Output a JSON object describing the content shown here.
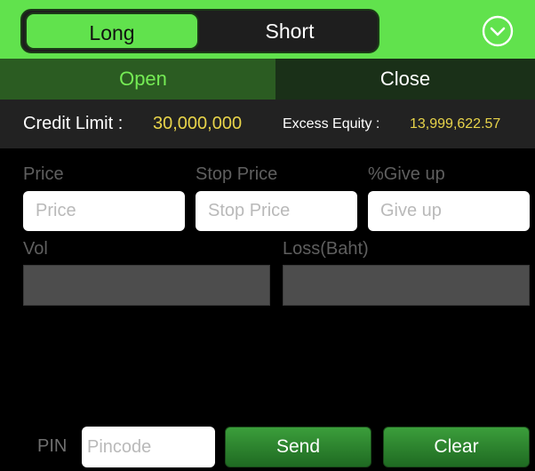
{
  "direction_toggle": {
    "long_label": "Long",
    "short_label": "Short",
    "selected": "Long"
  },
  "menu_icon": "chevron-down-circle-icon",
  "tabs": {
    "open_label": "Open",
    "close_label": "Close",
    "selected": "Open"
  },
  "credit": {
    "credit_limit_label": "Credit Limit :",
    "credit_limit_value": "30,000,000",
    "excess_equity_label": "Excess Equity :",
    "excess_equity_value": "13,999,622.57"
  },
  "form": {
    "price_label": "Price",
    "price_placeholder": "Price",
    "price_value": "",
    "stop_price_label": "Stop Price",
    "stop_price_placeholder": "Stop Price",
    "stop_price_value": "",
    "give_up_label": "%Give up",
    "give_up_placeholder": "Give up",
    "give_up_value": "",
    "vol_label": "Vol",
    "vol_value": "",
    "loss_label": "Loss(Baht)",
    "loss_value": ""
  },
  "footer": {
    "pin_label": "PIN",
    "pin_placeholder": "Pincode",
    "pin_value": "",
    "send_label": "Send",
    "clear_label": "Clear"
  },
  "colors": {
    "accent_green": "#61e24d",
    "value_yellow": "#e8d44a",
    "button_green": "#2d8a2e"
  }
}
